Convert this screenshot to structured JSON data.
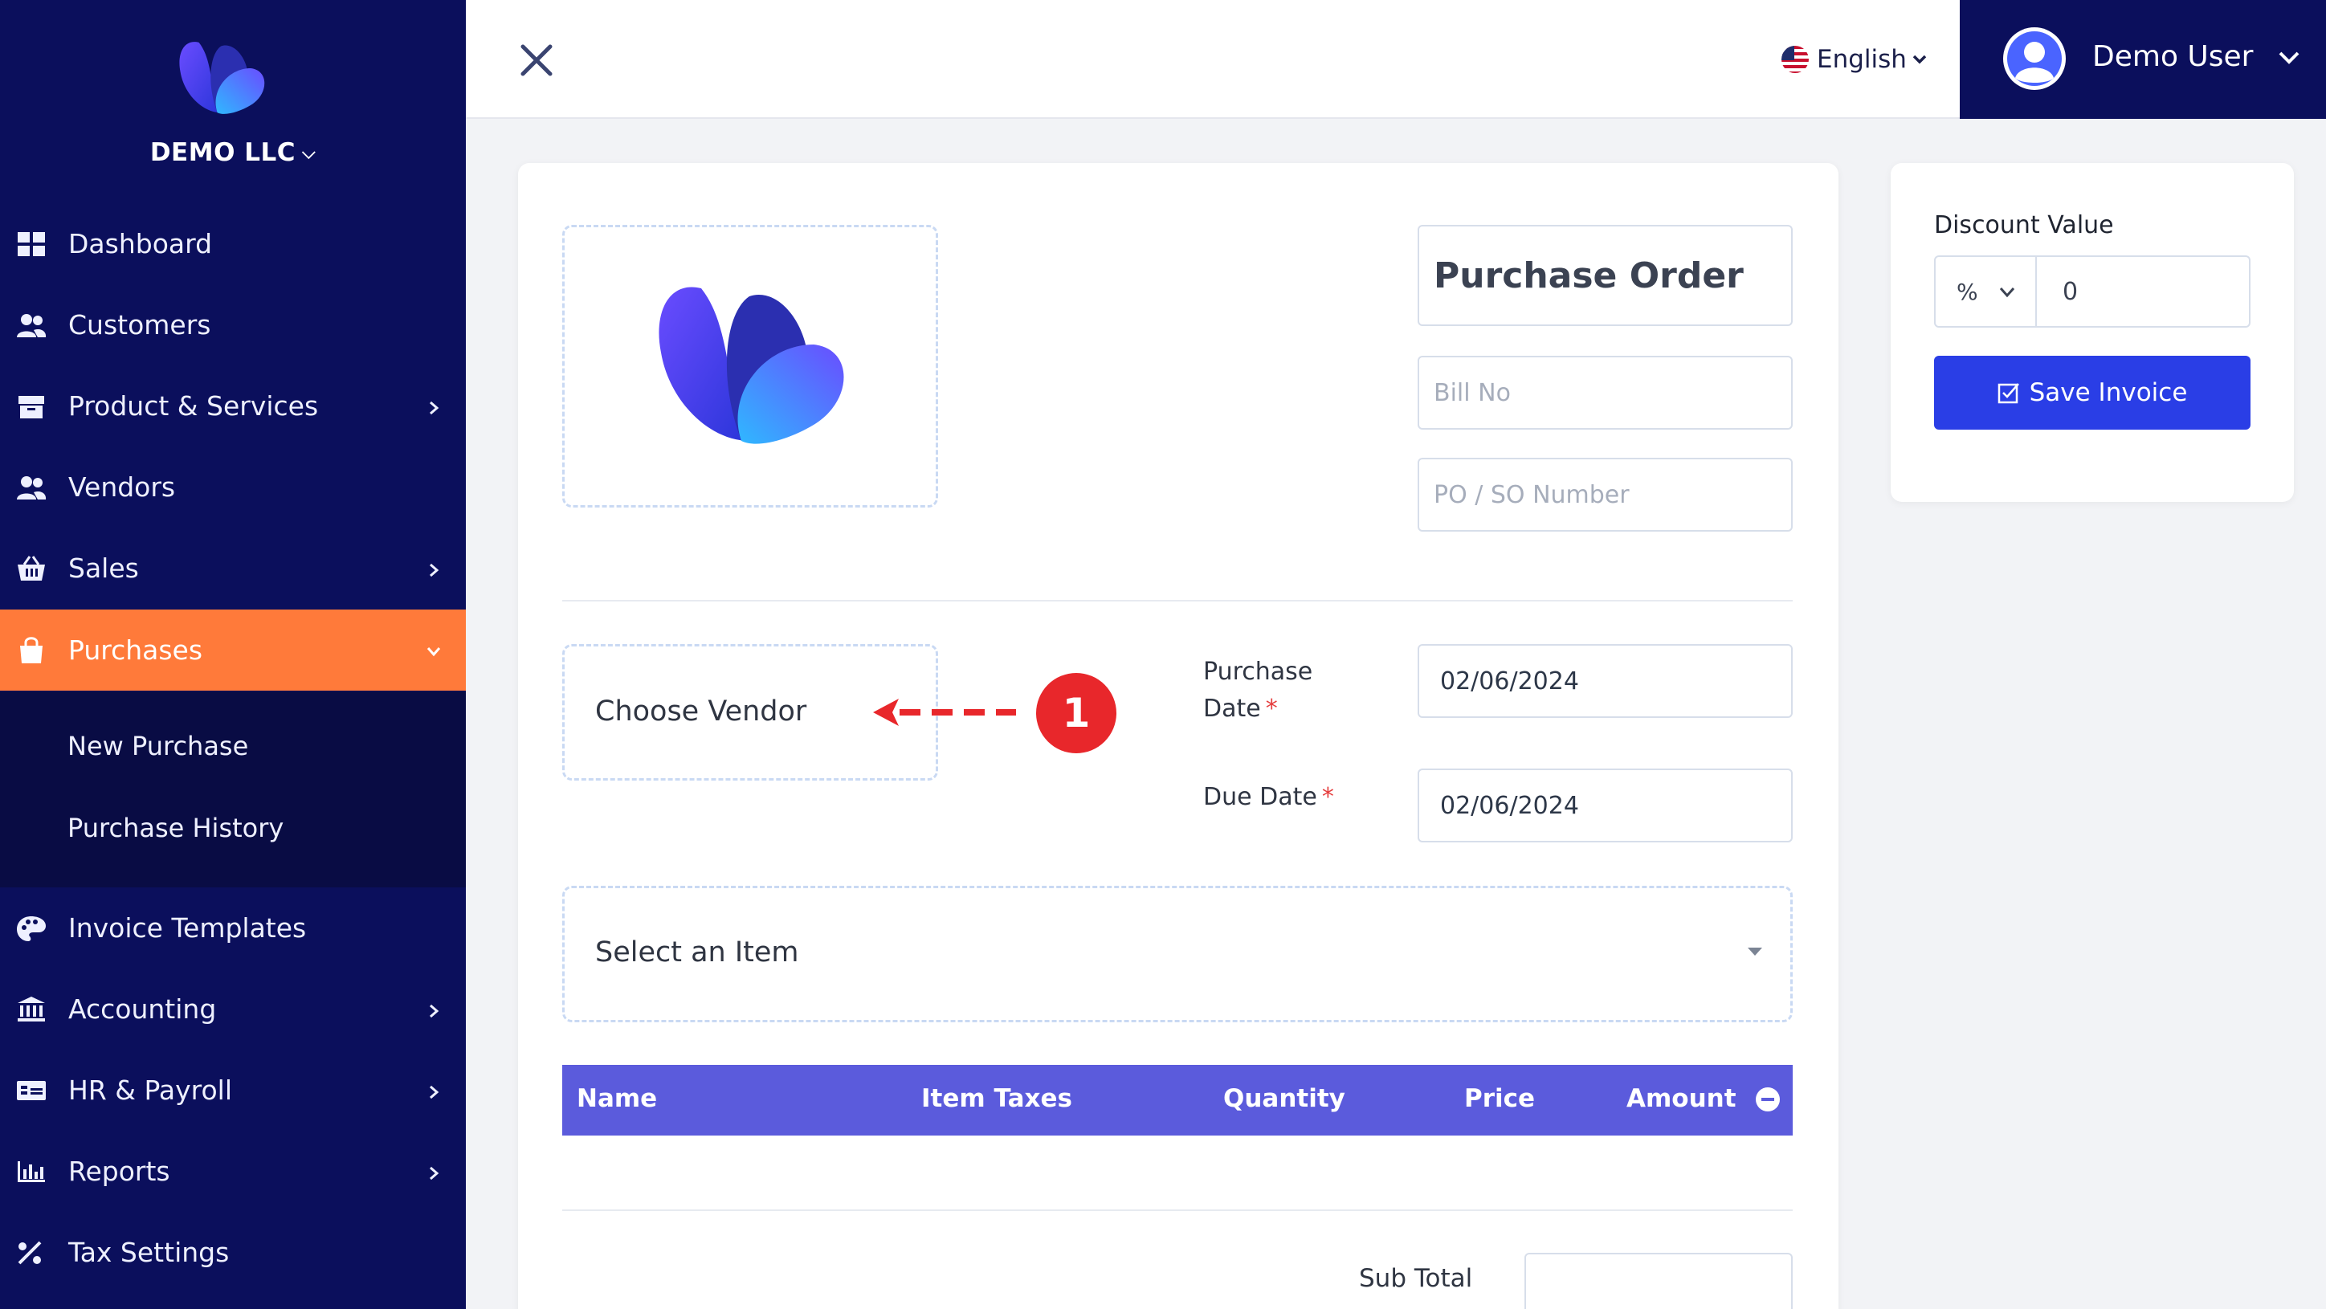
{
  "company": {
    "name": "DEMO LLC"
  },
  "nav": {
    "items": [
      {
        "label": "Dashboard",
        "icon": "dashboard-icon"
      },
      {
        "label": "Customers",
        "icon": "users-icon"
      },
      {
        "label": "Product & Services",
        "icon": "box-icon"
      },
      {
        "label": "Vendors",
        "icon": "users-icon"
      },
      {
        "label": "Sales",
        "icon": "basket-icon"
      },
      {
        "label": "Purchases",
        "icon": "shopping-bag-icon"
      },
      {
        "label": "Invoice Templates",
        "icon": "palette-icon"
      },
      {
        "label": "Accounting",
        "icon": "bank-icon"
      },
      {
        "label": "HR & Payroll",
        "icon": "money-card-icon"
      },
      {
        "label": "Reports",
        "icon": "bar-chart-icon"
      },
      {
        "label": "Tax Settings",
        "icon": "percent-icon"
      }
    ],
    "purchases_sub": [
      "New Purchase",
      "Purchase History"
    ]
  },
  "header": {
    "language": "English",
    "user_name": "Demo User"
  },
  "form": {
    "title": "Purchase Order",
    "bill_no_placeholder": "Bill No",
    "po_placeholder": "PO / SO Number",
    "vendor_label": "Choose Vendor",
    "annotation_number": "1",
    "purchase_date_label_1": "Purchase",
    "purchase_date_label_2": "Date",
    "required_mark": "*",
    "purchase_date": "02/06/2024",
    "due_date_label": "Due Date",
    "due_date": "02/06/2024",
    "item_select_label": "Select an Item",
    "columns": [
      "Name",
      "Item Taxes",
      "Quantity",
      "Price",
      "Amount"
    ],
    "subtotal_label": "Sub Total"
  },
  "discount": {
    "label": "Discount Value",
    "type": "%",
    "value": "0",
    "save_label": "Save Invoice"
  },
  "colors": {
    "sidebar": "#0b0f5c",
    "active": "#ff7a3a",
    "table_header": "#5b5bdc",
    "save_button": "#2a3ee6",
    "annotation": "#e8272b"
  }
}
